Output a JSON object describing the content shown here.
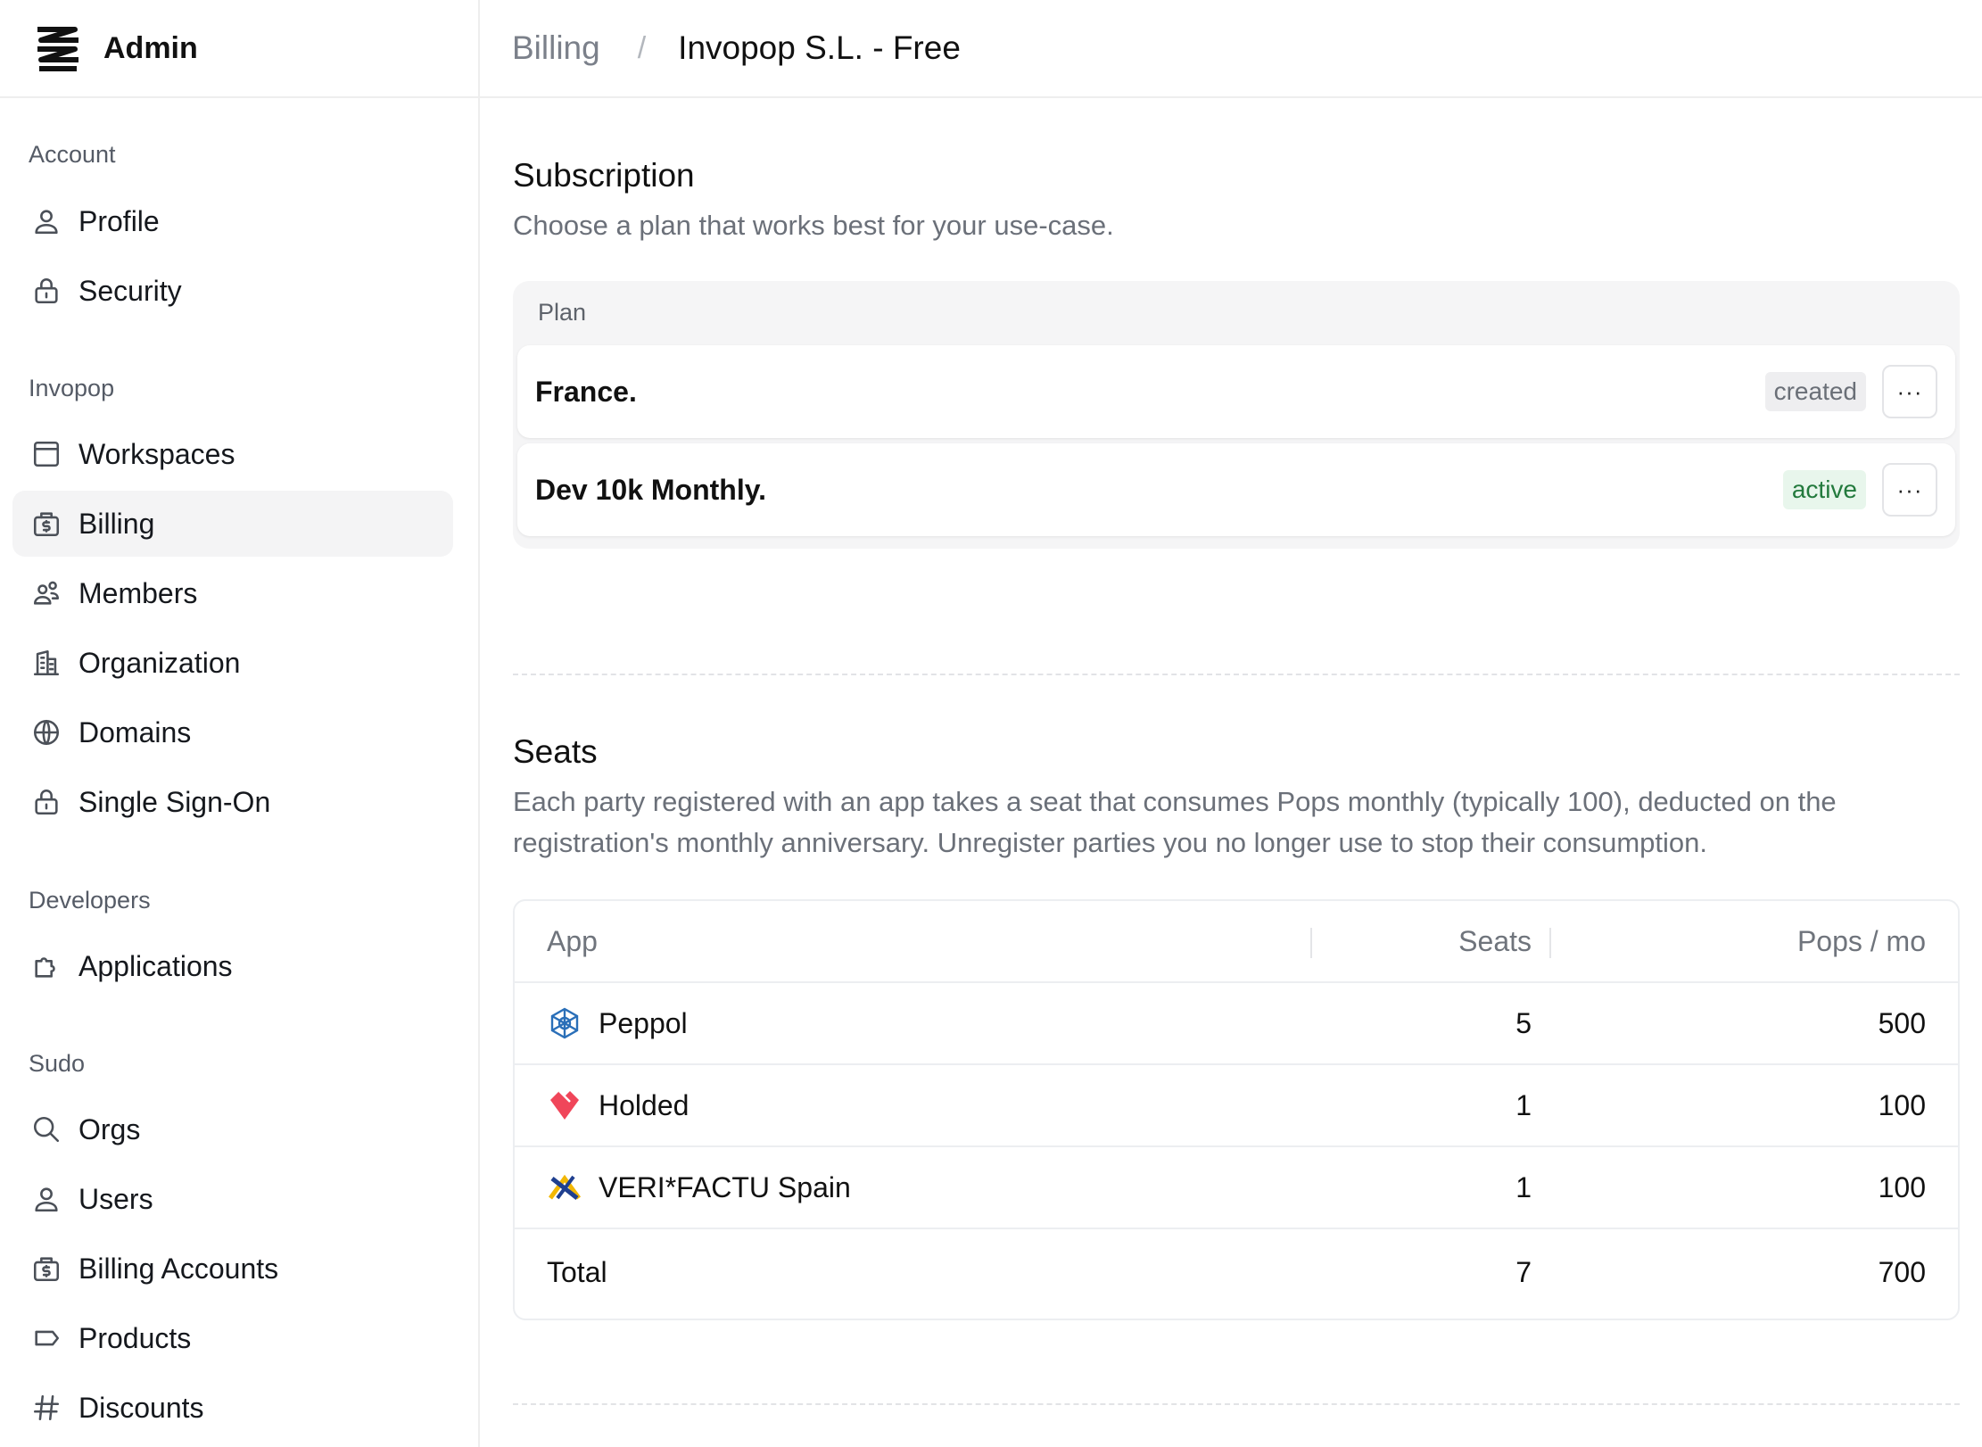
{
  "brand": {
    "name": "Admin"
  },
  "breadcrumb": {
    "parent": "Billing",
    "separator": "/",
    "current": "Invopop S.L. - Free"
  },
  "sidebar": {
    "groups": [
      {
        "title": "Account",
        "items": [
          {
            "label": "Profile",
            "icon": "user-icon"
          },
          {
            "label": "Security",
            "icon": "lock-icon"
          }
        ]
      },
      {
        "title": "Invopop",
        "items": [
          {
            "label": "Workspaces",
            "icon": "window-icon"
          },
          {
            "label": "Billing",
            "icon": "billing-icon",
            "active": true
          },
          {
            "label": "Members",
            "icon": "users-icon"
          },
          {
            "label": "Organization",
            "icon": "building-icon"
          },
          {
            "label": "Domains",
            "icon": "globe-icon"
          },
          {
            "label": "Single Sign-On",
            "icon": "lock-icon"
          }
        ]
      },
      {
        "title": "Developers",
        "items": [
          {
            "label": "Applications",
            "icon": "puzzle-icon"
          }
        ]
      },
      {
        "title": "Sudo",
        "items": [
          {
            "label": "Orgs",
            "icon": "search-icon"
          },
          {
            "label": "Users",
            "icon": "user-icon"
          },
          {
            "label": "Billing Accounts",
            "icon": "billing-icon"
          },
          {
            "label": "Products",
            "icon": "tag-icon"
          },
          {
            "label": "Discounts",
            "icon": "hash-icon"
          }
        ]
      }
    ]
  },
  "subscription": {
    "title": "Subscription",
    "description": "Choose a plan that works best for your use-case.",
    "plan_header": "Plan",
    "plans": [
      {
        "name": "France.",
        "status": "created",
        "menu": "···"
      },
      {
        "name": "Dev 10k Monthly.",
        "status": "active",
        "menu": "···"
      }
    ]
  },
  "seats": {
    "title": "Seats",
    "description": "Each party registered with an app takes a seat that consumes Pops monthly (typically 100), deducted on the registration's monthly anniversary. Unregister parties you no longer use to stop their consumption.",
    "columns": {
      "app": "App",
      "seats": "Seats",
      "pops": "Pops / mo"
    },
    "rows": [
      {
        "app": "Peppol",
        "icon": "peppol-icon",
        "seats": "5",
        "pops": "500"
      },
      {
        "app": "Holded",
        "icon": "holded-icon",
        "seats": "1",
        "pops": "100"
      },
      {
        "app": "VERI*FACTU Spain",
        "icon": "verifactu-icon",
        "seats": "1",
        "pops": "100"
      }
    ],
    "total": {
      "label": "Total",
      "seats": "7",
      "pops": "700"
    }
  },
  "colors": {
    "active_badge": "#237a3d",
    "active_badge_bg": "#e8f6ec",
    "holded": "#f0465a",
    "peppol": "#2a6fb8"
  }
}
